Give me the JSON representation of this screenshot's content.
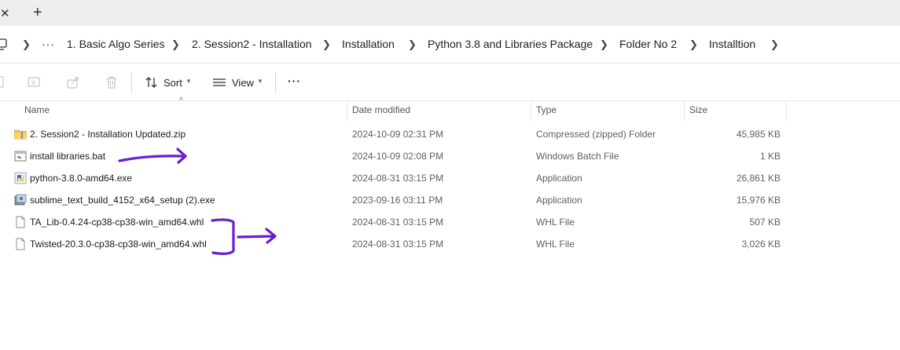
{
  "tabbar": {
    "close_glyph": "✕",
    "new_tab_glyph": "+"
  },
  "breadcrumb": {
    "more_glyph": "···",
    "items": [
      "1. Basic Algo Series",
      "2. Session2 - Installation",
      "Installation",
      "Python 3.8 and Libraries Package",
      "Folder No 2",
      "Installtion"
    ]
  },
  "toolbar": {
    "sort_label": "Sort",
    "view_label": "View",
    "more_glyph": "···"
  },
  "columns": {
    "name": "Name",
    "date": "Date modified",
    "type": "Type",
    "size": "Size"
  },
  "files": [
    {
      "name": "2. Session2 - Installation Updated.zip",
      "date": "2024-10-09 02:31 PM",
      "type": "Compressed (zipped) Folder",
      "size": "45,985 KB",
      "icon": "zip-folder-icon"
    },
    {
      "name": "install libraries.bat",
      "date": "2024-10-09 02:08 PM",
      "type": "Windows Batch File",
      "size": "1 KB",
      "icon": "batch-file-icon"
    },
    {
      "name": "python-3.8.0-amd64.exe",
      "date": "2024-08-31 03:15 PM",
      "type": "Application",
      "size": "26,861 KB",
      "icon": "python-installer-icon"
    },
    {
      "name": "sublime_text_build_4152_x64_setup (2).exe",
      "date": "2023-09-16 03:11 PM",
      "type": "Application",
      "size": "15,976 KB",
      "icon": "setup-installer-icon"
    },
    {
      "name": "TA_Lib-0.4.24-cp38-cp38-win_amd64.whl",
      "date": "2024-08-31 03:15 PM",
      "type": "WHL File",
      "size": "507 KB",
      "icon": "generic-file-icon"
    },
    {
      "name": "Twisted-20.3.0-cp38-cp38-win_amd64.whl",
      "date": "2024-08-31 03:15 PM",
      "type": "WHL File",
      "size": "3,026 KB",
      "icon": "generic-file-icon"
    }
  ],
  "colors": {
    "annotation": "#6a1fd1",
    "tabbar_bg": "#eeeeee",
    "secondary_text": "#5f5f5f"
  }
}
